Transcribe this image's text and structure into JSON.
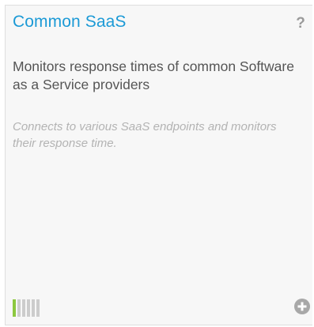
{
  "card": {
    "title": "Common SaaS",
    "help_icon": "question-mark-icon",
    "help_glyph": "?",
    "description": "Monitors response times of common Software as a Service providers",
    "detail": "Connects to various SaaS endpoints and monitors their response time.",
    "meter": {
      "total_segments": 6,
      "filled_segments": 1,
      "filled_color": "#8cc83f",
      "empty_color": "#cccccc"
    },
    "add_icon": "plus-circle-icon",
    "title_color": "#1c9ad6"
  }
}
